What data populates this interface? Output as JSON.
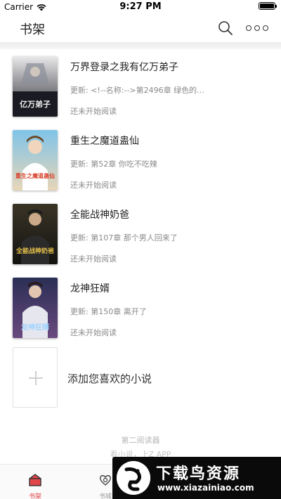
{
  "status_bar": {
    "carrier": "Carrier",
    "time": "9:27 PM",
    "battery_level": 1.0
  },
  "nav": {
    "title": "书架",
    "search_icon": "search-icon",
    "more_icon": "more-icon"
  },
  "books": [
    {
      "title": "万界登录之我有亿万弟子",
      "update": "更新: <!--名称:-->第2496章 绿色的...",
      "status": "还未开始阅读",
      "cover_text": "亿万弟子",
      "cover_colors": [
        "#e9e9ea",
        "#2b2b33"
      ]
    },
    {
      "title": "重生之魔道蛊仙",
      "update": "更新: 第52章 你吃不吃辣",
      "status": "还未开始阅读",
      "cover_text": "重生之魔道蛊仙",
      "cover_colors": [
        "#7fc4e8",
        "#e8d6b8"
      ]
    },
    {
      "title": "全能战神奶爸",
      "update": "更新: 第107章 那个男人回来了",
      "status": "还未开始阅读",
      "cover_text": "全能战神奶爸",
      "cover_colors": [
        "#3a3426",
        "#121210"
      ]
    },
    {
      "title": "龙神狂婿",
      "update": "更新: 第150章 离开了",
      "status": "还未开始阅读",
      "cover_text": "龙神狂婿",
      "cover_colors": [
        "#2a2e55",
        "#6a4a7e"
      ]
    }
  ],
  "add_book": {
    "label": "添加您喜欢的小说"
  },
  "footer": {
    "line1": "第二阅读器",
    "line2": "看小说，上Z APP"
  },
  "tabs": [
    {
      "label": "书架",
      "icon": "bookshelf-icon",
      "active": true
    },
    {
      "label": "书城",
      "icon": "bookstore-icon",
      "active": false
    }
  ],
  "watermark": {
    "main": "下载鸟资源",
    "url": "www.xiazainiao.com"
  },
  "colors": {
    "accent": "#e0454a",
    "text": "#222222",
    "muted": "#8a8a8a"
  }
}
